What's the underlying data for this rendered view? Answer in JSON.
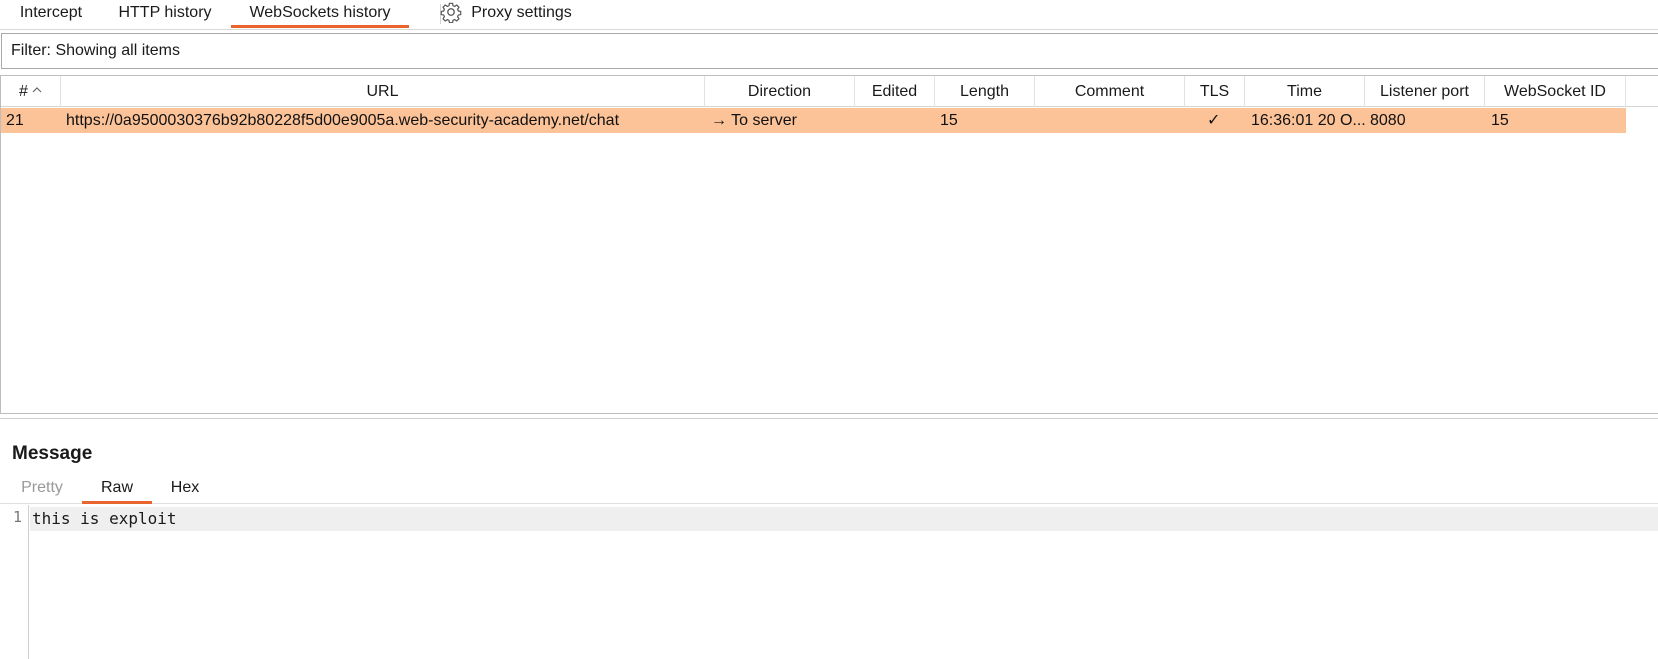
{
  "tabs": [
    {
      "label": "Intercept"
    },
    {
      "label": "HTTP history"
    },
    {
      "label": "WebSockets history"
    },
    {
      "label": "Proxy settings",
      "icon": "gear-icon"
    }
  ],
  "active_tab": "WebSockets history",
  "accent_color": "#e8662d",
  "selected_row_color": "#fdc398",
  "filter": {
    "text": "Filter: Showing all items"
  },
  "table": {
    "columns": [
      "#",
      "URL",
      "Direction",
      "Edited",
      "Length",
      "Comment",
      "TLS",
      "Time",
      "Listener port",
      "WebSocket ID"
    ],
    "sort_column": "#",
    "rows": [
      {
        "num": "21",
        "url": "https://0a9500030376b92b80228f5d00e9005a.web-security-academy.net/chat",
        "direction_arrow": "→",
        "direction": "To server",
        "edited": "",
        "length": "15",
        "comment": "",
        "tls": "✓",
        "time": "16:36:01 20 O...",
        "listener_port": "8080",
        "websocket_id": "15"
      }
    ]
  },
  "message": {
    "title": "Message",
    "tabs": [
      {
        "label": "Pretty"
      },
      {
        "label": "Raw"
      },
      {
        "label": "Hex"
      }
    ],
    "active_tab": "Raw",
    "lines": [
      {
        "number": "1",
        "text": "this is exploit"
      }
    ]
  }
}
